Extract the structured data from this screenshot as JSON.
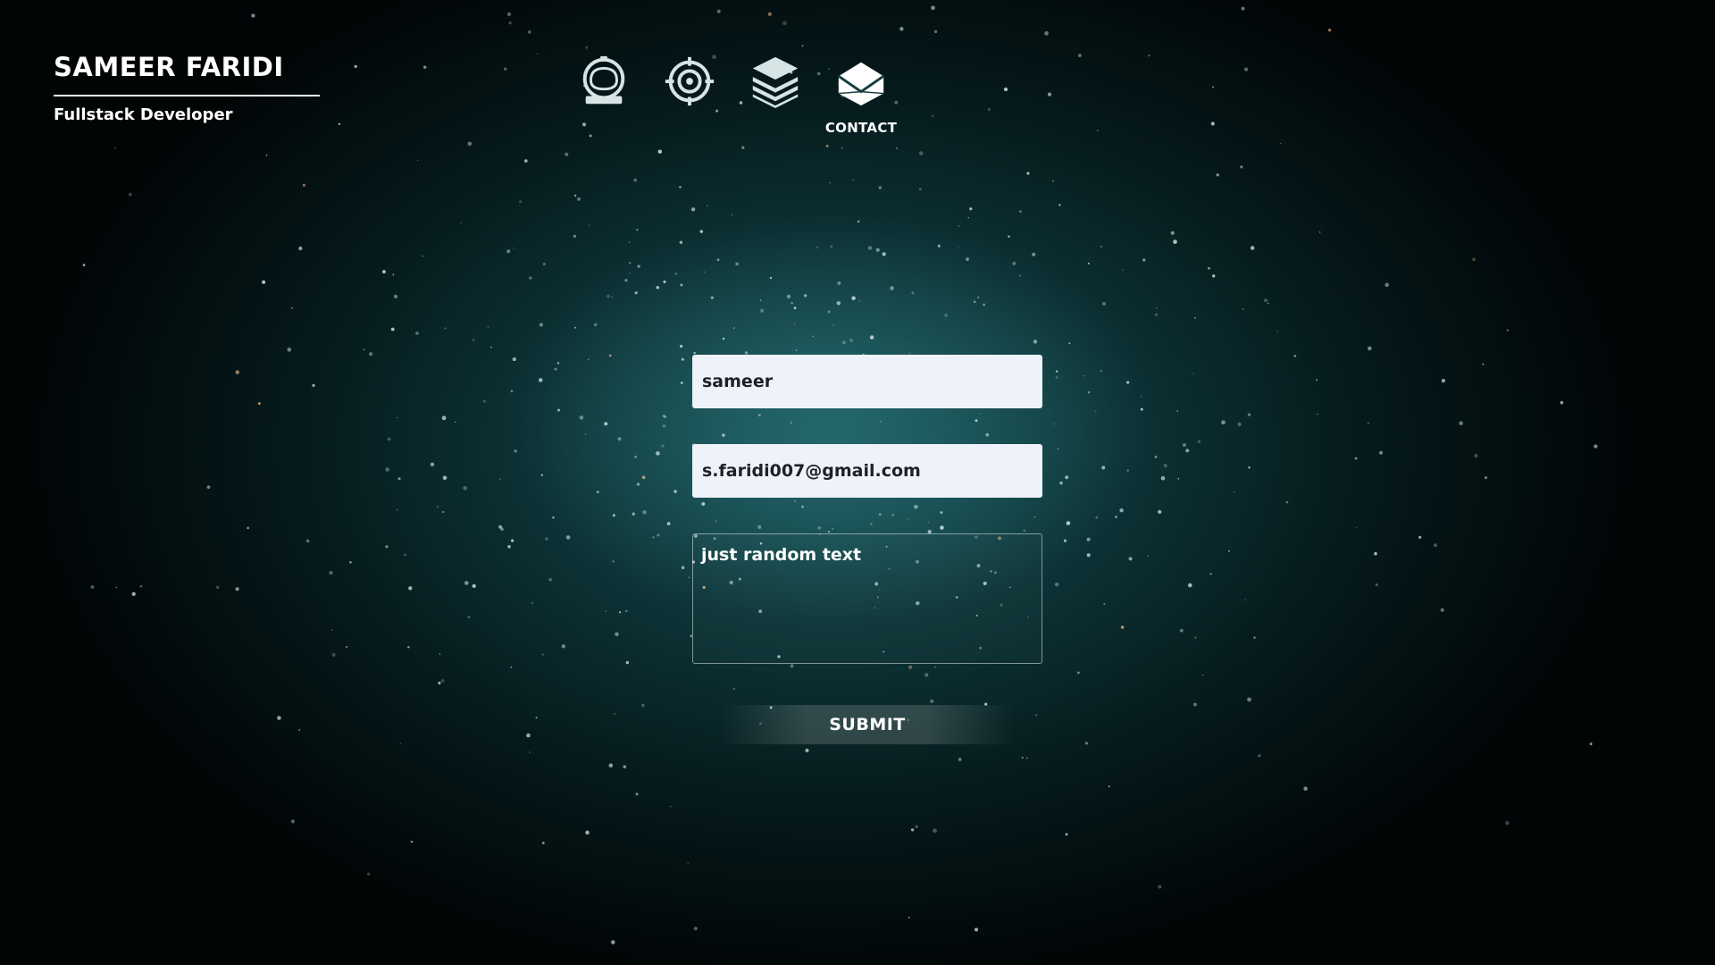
{
  "brand": {
    "name": "SAMEER FARIDI",
    "subtitle": "Fullstack Developer"
  },
  "nav": {
    "items": [
      {
        "icon": "astronaut-helmet-icon",
        "label": ""
      },
      {
        "icon": "target-gear-icon",
        "label": ""
      },
      {
        "icon": "stacked-layers-icon",
        "label": ""
      },
      {
        "icon": "envelope-icon",
        "label": "CONTACT"
      }
    ]
  },
  "form": {
    "name_value": "sameer",
    "email_value": "s.faridi007@gmail.com",
    "message_value": "just random text",
    "submit_label": "SUBMIT"
  },
  "colors": {
    "background": "#0d3437",
    "input_background": "#eef2f9",
    "input_text": "#1c2228",
    "text": "#ffffff"
  }
}
